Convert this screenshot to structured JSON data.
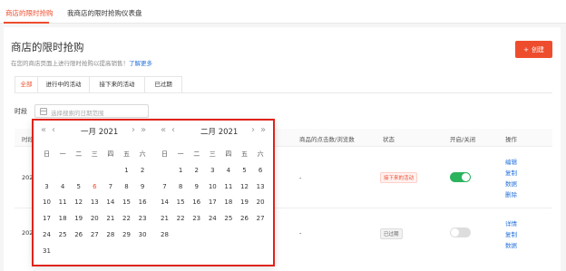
{
  "top_tabs": [
    {
      "label": "商店的限时抢购"
    },
    {
      "label": "我商店的限时抢购仪表盘"
    }
  ],
  "page": {
    "title": "商店的限时抢购",
    "description": "在您的商店页面上进行限时抢购以提高销售！",
    "learn_more": "了解更多",
    "create_label": "创建",
    "create_icon": "plus-icon"
  },
  "filter_tabs": [
    {
      "label": "全部"
    },
    {
      "label": "进行中的活动"
    },
    {
      "label": "接下来的活动"
    },
    {
      "label": "已过期"
    }
  ],
  "period": {
    "label": "时段",
    "placeholder": "选择搜索的日期范围"
  },
  "table": {
    "headers": [
      "时段",
      "商品的点击数/浏览数",
      "状态",
      "开启/关闭",
      "操作"
    ],
    "rows": [
      {
        "period": "2021",
        "clicks": "-",
        "status": "接下来的活动",
        "toggle_on": true,
        "actions": [
          "编辑",
          "复制",
          "数据",
          "删除"
        ]
      },
      {
        "period": "2020",
        "clicks": "-",
        "status": "已过期",
        "toggle_on": false,
        "actions": [
          "详情",
          "复制",
          "数据"
        ]
      }
    ]
  },
  "picker": {
    "left_month": "一月 2021",
    "right_month": "二月 2021",
    "weekdays": [
      "日",
      "一",
      "二",
      "三",
      "四",
      "五",
      "六"
    ],
    "left_start_col": 5,
    "left_days": 31,
    "left_highlight_day": 6,
    "right_start_col": 1,
    "right_days": 28,
    "nav_prev_year": "«",
    "nav_prev_month": "‹",
    "nav_next_month": "›",
    "nav_next_year": "»",
    "highlight_color": "#ee4d2d"
  }
}
